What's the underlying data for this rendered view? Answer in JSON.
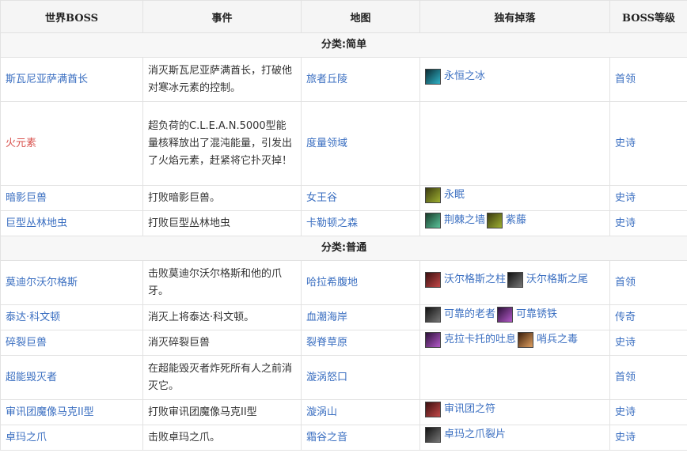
{
  "headers": [
    "世界BOSS",
    "事件",
    "地图",
    "独有掉落",
    "BOSS等级"
  ],
  "categories": [
    "分类:简单",
    "分类:普通"
  ],
  "rows_simple": [
    {
      "boss": "斯瓦尼亚萨满酋长",
      "event": "消灭斯瓦尼亚萨满酋长，打破他对寒冰元素的控制。",
      "map": "旅者丘陵",
      "loot": [
        {
          "icon": "frost-icon",
          "color": "teal",
          "name": "永恒之冰"
        }
      ],
      "level": "首领"
    },
    {
      "boss": "火元素",
      "event": "超负荷的C.L.E.A.N.5000型能量核释放出了混沌能量，引发出了火焰元素，赶紧将它扑灭掉！",
      "map": "度量领域",
      "loot": [],
      "level": "史诗"
    },
    {
      "boss": "暗影巨兽",
      "event": "打败暗影巨兽。",
      "map": "女王谷",
      "loot": [
        {
          "icon": "eternal-sleep-icon",
          "color": "olive",
          "name": "永眠"
        }
      ],
      "level": "史诗"
    },
    {
      "boss": "巨型丛林地虫",
      "event": "打败巨型丛林地虫",
      "map": "卡勒顿之森",
      "loot": [
        {
          "icon": "thorn-wall-icon",
          "color": "green",
          "name": "荆棘之墙"
        },
        {
          "icon": "wisteria-icon",
          "color": "olive",
          "name": "紫藤"
        }
      ],
      "level": "史诗"
    }
  ],
  "rows_normal": [
    {
      "boss": "莫迪尔沃尔格斯",
      "event": "击败莫迪尔沃尔格斯和他的爪牙。",
      "map": "哈拉希腹地",
      "loot": [
        {
          "icon": "pillar-icon",
          "color": "red",
          "name": "沃尔格斯之柱"
        },
        {
          "icon": "tail-icon",
          "color": "dark",
          "name": "沃尔格斯之尾"
        }
      ],
      "level": "首领"
    },
    {
      "boss": "泰达·科文顿",
      "event": "消灭上将泰达·科文顿。",
      "map": "血潮海岸",
      "loot": [
        {
          "icon": "old-one-icon",
          "color": "dark",
          "name": "可靠的老者"
        },
        {
          "icon": "rusty-iron-icon",
          "color": "purple",
          "name": "可靠锈铁"
        }
      ],
      "level": "传奇"
    },
    {
      "boss": "碎裂巨兽",
      "event": "消灭碎裂巨兽",
      "map": "裂脊草原",
      "loot": [
        {
          "icon": "breath-icon",
          "color": "purple",
          "name": "克拉卡托的吐息"
        },
        {
          "icon": "sentinel-poison-icon",
          "color": "orange",
          "name": "哨兵之毒"
        }
      ],
      "level": "史诗"
    },
    {
      "boss": "超能毁灭者",
      "event": "在超能毁灭者炸死所有人之前消灭它。",
      "map": "漩涡怒口",
      "loot": [],
      "level": "首领"
    },
    {
      "boss": "审讯团魔像马克II型",
      "event": "打败审讯团魔像马克II型",
      "map": "漩涡山",
      "loot": [
        {
          "icon": "inquest-rune-icon",
          "color": "red",
          "name": "审讯团之符"
        }
      ],
      "level": "史诗"
    },
    {
      "boss": "卓玛之爪",
      "event": "击败卓玛之爪。",
      "map": "霜谷之音",
      "loot": [
        {
          "icon": "claw-shard-icon",
          "color": "dark",
          "name": "卓玛之爪裂片"
        }
      ],
      "level": "史诗"
    }
  ]
}
